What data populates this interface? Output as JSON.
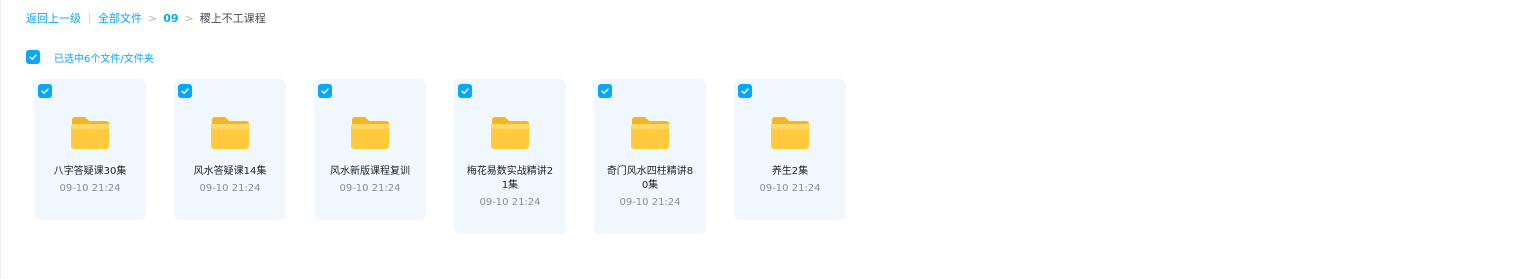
{
  "breadcrumb": {
    "back": "返回上一级",
    "all_files": "全部文件",
    "folder": "09",
    "current": "稷上不工课程"
  },
  "selection": {
    "summary": "已选中6个文件/文件夹",
    "checked": true
  },
  "colors": {
    "accent": "#06a7ff",
    "card_bg": "#f0f7fd",
    "folder_yellow": "#ffc93c"
  },
  "files": [
    {
      "name": "八字答疑课30集",
      "time": "09-10 21:24",
      "icon": "folder-icon",
      "checked": true
    },
    {
      "name": "风水答疑课14集",
      "time": "09-10 21:24",
      "icon": "folder-icon",
      "checked": true
    },
    {
      "name": "风水新版课程复训",
      "time": "09-10 21:24",
      "icon": "folder-icon",
      "checked": true
    },
    {
      "name": "梅花易数实战精讲21集",
      "time": "09-10 21:24",
      "icon": "folder-icon",
      "checked": true
    },
    {
      "name": "奇门风水四柱精讲80集",
      "time": "09-10 21:24",
      "icon": "folder-icon",
      "checked": true
    },
    {
      "name": "养生2集",
      "time": "09-10 21:24",
      "icon": "folder-icon",
      "checked": true
    }
  ]
}
